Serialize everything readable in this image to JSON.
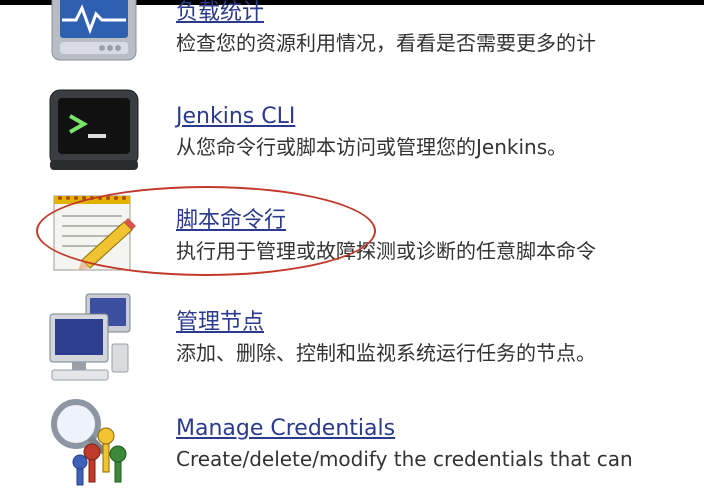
{
  "items": [
    {
      "icon": "load-statistics-monitor-icon",
      "title": "负载统计",
      "desc": "检查您的资源利用情况，看看是否需要更多的计"
    },
    {
      "icon": "terminal-icon",
      "title": "Jenkins CLI",
      "desc": "从您命令行或脚本访问或管理您的Jenkins。"
    },
    {
      "icon": "notepad-pencil-icon",
      "title": "脚本命令行",
      "desc": "执行用于管理或故障探测或诊断的任意脚本命令"
    },
    {
      "icon": "computers-network-icon",
      "title": "管理节点",
      "desc": "添加、删除、控制和监视系统运行任务的节点。"
    },
    {
      "icon": "keys-magnifier-icon",
      "title": "Manage Credentials",
      "desc": "Create/delete/modify the credentials that can"
    }
  ],
  "colors": {
    "link": "#2b3a8c",
    "highlight": "#c0392b"
  }
}
